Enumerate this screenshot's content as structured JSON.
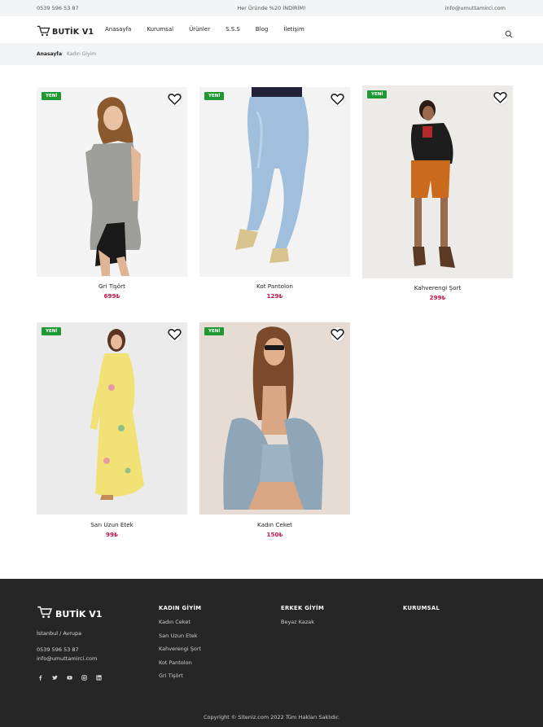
{
  "topbar": {
    "phone": "0539 596 53 87",
    "promo": "Her Üründe %20 İNDİRİM!",
    "email": "info@umuttamirci.com"
  },
  "header": {
    "brand": "BUTİK V1",
    "nav": [
      "Anasayfa",
      "Kurumsal",
      "Ürünler",
      "S.S.S",
      "Blog",
      "İletişim"
    ]
  },
  "breadcrumb": {
    "home": "Anasayfa",
    "separator": "/",
    "current": "Kadın Giyim"
  },
  "products": [
    {
      "name": "Gri Tişört",
      "price": "699₺",
      "badge": "YENİ"
    },
    {
      "name": "Kot Pantolon",
      "price": "129₺",
      "badge": "YENİ"
    },
    {
      "name": "Kahverengi Şort",
      "price": "299₺",
      "badge": "YENİ"
    },
    {
      "name": "Sarı Uzun Etek",
      "price": "99₺",
      "badge": "YENİ"
    },
    {
      "name": "Kadın Ceket",
      "price": "150₺",
      "badge": "YENİ"
    }
  ],
  "footer": {
    "brand": "BUTİK V1",
    "city": "İstanbul / Avrupa",
    "phone": "0539 596 53 87",
    "email": "info@umuttamirci.com",
    "social_icons": [
      "facebook-icon",
      "twitter-icon",
      "youtube-icon",
      "instagram-icon",
      "linkedin-icon"
    ],
    "columns": [
      {
        "title": "KADIN GİYİM",
        "items": [
          "Kadın Ceket",
          "Sarı Uzun Etek",
          "Kahverengi Şort",
          "Kot Pantolon",
          "Gri Tişört"
        ]
      },
      {
        "title": "ERKEK GİYİM",
        "items": [
          "Beyaz Kazak"
        ]
      },
      {
        "title": "KURUMSAL",
        "items": []
      }
    ],
    "copyright": "Copyright © Siteniz.com 2022 Tüm Hakları Saklıdır."
  },
  "colors": {
    "badge": "#1f9a33",
    "price": "#c0194a",
    "footer_bg": "#262626",
    "topbar_bg": "#f3f4f6"
  }
}
